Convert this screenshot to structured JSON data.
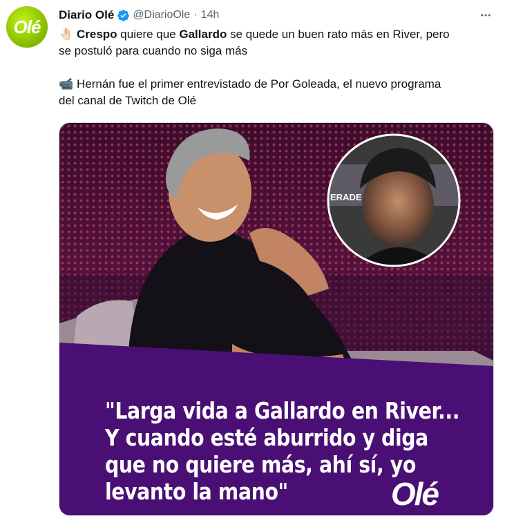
{
  "tweet": {
    "author": {
      "name": "Diario Olé",
      "handle": "@DiarioOle",
      "avatar_text": "Olé",
      "verified": true
    },
    "separator": "·",
    "time": "14h",
    "more_icon": "more-horizontal-icon",
    "text": {
      "line1": {
        "emoji": "🤚🏻",
        "bold1": "Crespo",
        "mid1": " quiere que ",
        "bold2": "Gallardo",
        "tail": " se quede un buen rato más en River, pero"
      },
      "line2": "se postuló para cuando no siga más",
      "line3": {
        "emoji": "📹",
        "text": "Hernán fue el primer entrevistado de Por Goleada, el nuevo programa"
      },
      "line4": "del canal de Twitch de Olé"
    },
    "media": {
      "quote_lines": [
        "\"Larga vida a Gallardo en River...",
        "Y cuando esté aburrido y diga",
        "que no quiere más, ahí sí, yo",
        "levanto la mano\""
      ],
      "logo": "Olé",
      "inset_text": "ERADE",
      "colors": {
        "purple": "#4a0f74",
        "accent": "#d81e5b"
      }
    }
  },
  "colors": {
    "text": "#0f1419",
    "secondary": "#536471",
    "verified": "#1d9bf0",
    "avatar": "#8fc500"
  }
}
